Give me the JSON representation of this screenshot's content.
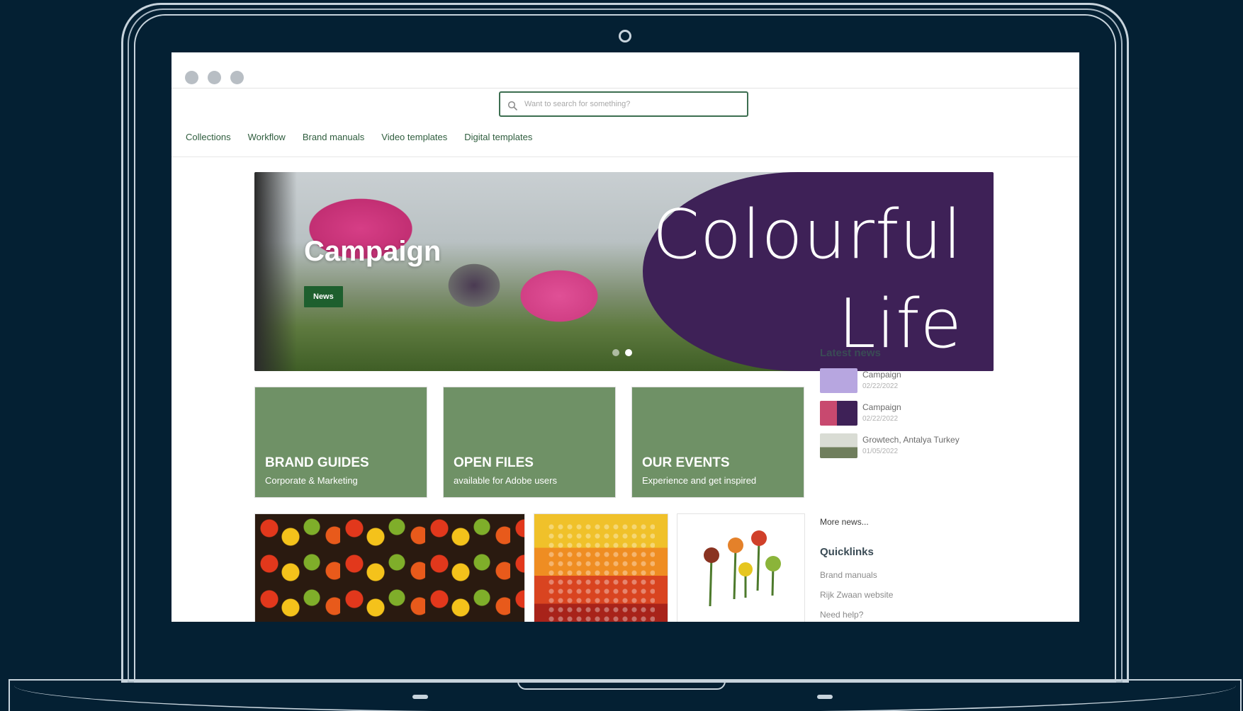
{
  "search": {
    "placeholder": "Want to search for something?"
  },
  "nav": [
    "Collections",
    "Workflow",
    "Brand manuals",
    "Video templates",
    "Digital templates"
  ],
  "hero": {
    "title": "Campaign",
    "badge": "News",
    "banner_words": [
      "Colourful",
      "Life"
    ],
    "slide_count": 2,
    "active_slide": 2
  },
  "tiles": [
    {
      "title": "BRAND GUIDES",
      "subtitle": "Corporate & Marketing"
    },
    {
      "title": "OPEN FILES",
      "subtitle": "available for Adobe users"
    },
    {
      "title": "OUR EVENTS",
      "subtitle": "Experience and get inspired"
    }
  ],
  "sidebar": {
    "latest_news_heading": "Latest news",
    "news": [
      {
        "title": "Campaign",
        "date": "02/22/2022"
      },
      {
        "title": "Campaign",
        "date": "02/22/2022"
      },
      {
        "title": "Growtech, Antalya Turkey",
        "date": "01/05/2022"
      }
    ],
    "more_news": "More news...",
    "quicklinks_heading": "Quicklinks",
    "quicklinks": [
      "Brand manuals",
      "Rijk Zwaan website",
      "Need help?"
    ]
  },
  "colors": {
    "background": "#042033",
    "accent_green": "#1e5f2e",
    "tile_green": "#6f9166",
    "banner_purple": "#3e2157",
    "nav_text": "#2f5d3e"
  }
}
